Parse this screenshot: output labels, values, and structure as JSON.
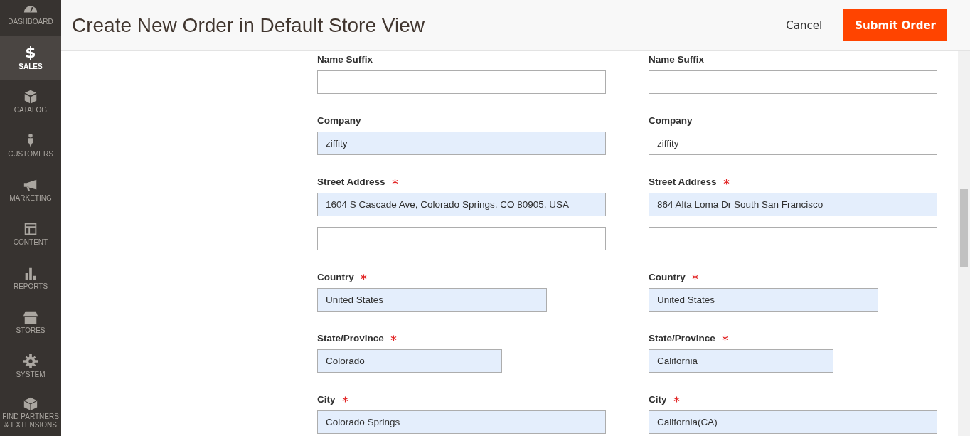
{
  "sidebar": {
    "items": [
      {
        "label": "DASHBOARD",
        "selected": false
      },
      {
        "label": "SALES",
        "selected": true,
        "glyph": "$"
      },
      {
        "label": "CATALOG",
        "selected": false
      },
      {
        "label": "CUSTOMERS",
        "selected": false
      },
      {
        "label": "MARKETING",
        "selected": false
      },
      {
        "label": "CONTENT",
        "selected": false
      },
      {
        "label": "REPORTS",
        "selected": false
      },
      {
        "label": "STORES",
        "selected": false
      },
      {
        "label": "SYSTEM",
        "selected": false
      },
      {
        "label": "FIND PARTNERS & EXTENSIONS",
        "selected": false
      }
    ]
  },
  "header": {
    "title": "Create New Order in Default Store View",
    "cancel": "Cancel",
    "submit": "Submit Order"
  },
  "columns": [
    {
      "fields": [
        {
          "label": "Name Suffix",
          "required": false,
          "kind": "text",
          "autofilled": false
        },
        {
          "label": "Company",
          "required": false,
          "kind": "text",
          "value": "ziffity",
          "autofilled": true
        },
        {
          "label": "Street Address",
          "required": true,
          "kind": "text",
          "value": "1604 S Cascade Ave, Colorado Springs, CO 80905, USA",
          "autofilled": true,
          "extra_line": true
        },
        {
          "label": "Country",
          "required": true,
          "kind": "select",
          "value": "United States",
          "autofilled": true
        },
        {
          "label": "State/Province",
          "required": true,
          "kind": "state",
          "value": "Colorado",
          "autofilled": true
        },
        {
          "label": "City",
          "required": true,
          "kind": "text",
          "value": "Colorado Springs",
          "autofilled": true
        }
      ]
    },
    {
      "fields": [
        {
          "label": "Name Suffix",
          "required": false,
          "kind": "text",
          "autofilled": false
        },
        {
          "label": "Company",
          "required": false,
          "kind": "text",
          "value": "ziffity",
          "autofilled": false
        },
        {
          "label": "Street Address",
          "required": true,
          "kind": "text",
          "value": "864 Alta Loma Dr South San Francisco",
          "autofilled": true,
          "extra_line": true
        },
        {
          "label": "Country",
          "required": true,
          "kind": "select",
          "value": "United States",
          "autofilled": true
        },
        {
          "label": "State/Province",
          "required": true,
          "kind": "state",
          "value": "California",
          "autofilled": true
        },
        {
          "label": "City",
          "required": true,
          "kind": "text",
          "value": "California(CA)",
          "autofilled": true
        }
      ]
    }
  ]
}
